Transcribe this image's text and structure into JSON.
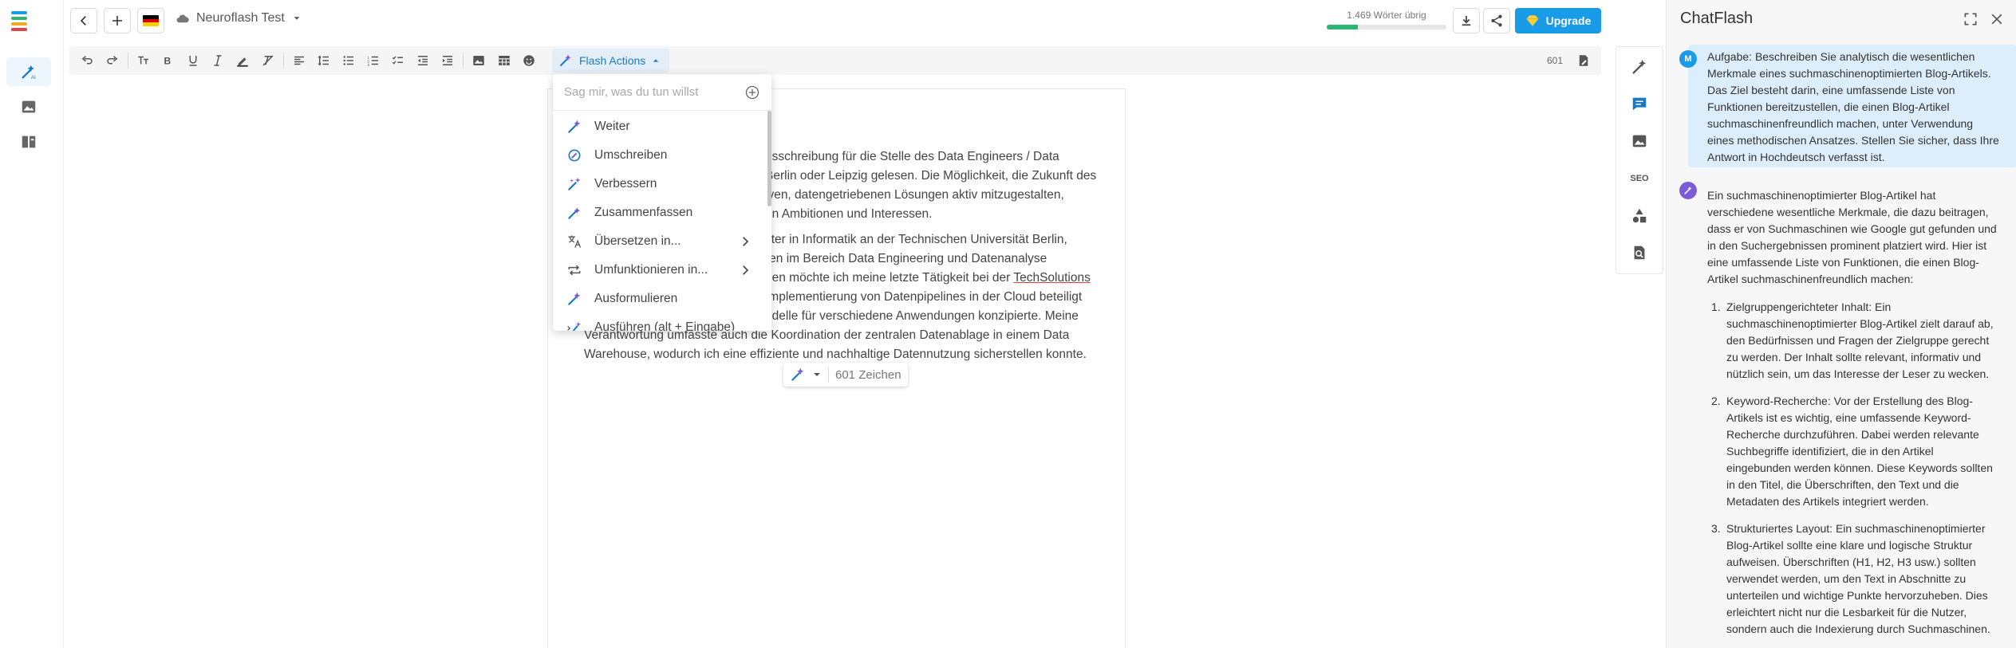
{
  "topbar": {
    "back_icon": "chevron-left-icon",
    "add_icon": "plus-icon",
    "language_flag": "german-flag",
    "doc_name": "Neuroflash Test",
    "words_left_label": "1.469 Wörter übrig",
    "words_progress": 0.26,
    "upgrade_label": "Upgrade"
  },
  "toolbar": {
    "flash_actions_label": "Flash Actions",
    "char_count": "601"
  },
  "document": {
    "lines": [
      "usschreibung für die Stelle des Data Engineers / Data",
      "Berlin oder Leipzig gelesen. Die Möglichkeit, die Zukunft des",
      "iven, datengetriebenen Lösungen aktiv mitzugestalten,",
      "en Ambitionen und Interessen.",
      "ster in Informatik an der Technischen Universität Berlin,",
      "ren im Bereich Data Engineering und Datenanalyse",
      "ben möchte ich meine letzte Tätigkeit bei der ",
      " Implementierung von Datenpipelines in der Cloud beteiligt",
      "odelle für verschiedene Anwendungen konzipierte. Meine",
      "Verantwortung umfasste auch die Koordination der zentralen Datenablage in einem Data",
      "Warehouse, wodurch ich eine effiziente und nachhaltige Datennutzung sicherstellen konnte."
    ],
    "highlight_word": "TechSolutions"
  },
  "menu": {
    "placeholder": "Sag mir, was du tun willst",
    "items": [
      {
        "label": "Weiter"
      },
      {
        "label": "Umschreiben"
      },
      {
        "label": "Verbessern"
      },
      {
        "label": "Zusammenfassen"
      },
      {
        "label": "Übersetzen in..."
      },
      {
        "label": "Umfunktionieren in..."
      },
      {
        "label": "Ausformulieren"
      },
      {
        "label": "Ausführen (alt + Eingabe)"
      }
    ]
  },
  "char_pill": {
    "label": "601 Zeichen"
  },
  "tool_strip": {
    "seo_label": "SEO"
  },
  "chat": {
    "title": "ChatFlash",
    "user_avatar": "M",
    "user_message": [
      "Aufgabe: Beschreiben Sie analytisch die wesentlichen",
      "Merkmale eines suchmaschinenoptimierten Blog-Artikels.",
      "Das Ziel besteht darin, eine umfassende Liste von",
      "Funktionen bereitzustellen, die einen Blog-Artikel",
      "suchmaschinenfreundlich machen, unter Verwendung",
      "eines methodischen Ansatzes. Stellen Sie sicher, dass Ihre",
      "Antwort in Hochdeutsch verfasst ist."
    ],
    "reply_intro": [
      "Ein suchmaschinenoptimierter Blog-Artikel hat",
      "verschiedene wesentliche Merkmale, die dazu beitragen,",
      "dass er von Suchmaschinen wie Google gut gefunden und",
      "in den Suchergebnissen prominent platziert wird. Hier ist",
      "eine umfassende Liste von Funktionen, die einen Blog-",
      "Artikel suchmaschinenfreundlich machen:"
    ],
    "reply_points": [
      {
        "num": "1.",
        "lines": [
          "Zielgruppengerichteter Inhalt: Ein",
          "suchmaschinenoptimierter Blog-Artikel zielt darauf ab,",
          "den Bedürfnissen und Fragen der Zielgruppe gerecht",
          "zu werden. Der Inhalt sollte relevant, informativ und",
          "nützlich sein, um das Interesse der Leser zu wecken."
        ]
      },
      {
        "num": "2.",
        "lines": [
          "Keyword-Recherche: Vor der Erstellung des Blog-",
          "Artikels ist es wichtig, eine umfassende Keyword-",
          "Recherche durchzuführen. Dabei werden relevante",
          "Suchbegriffe identifiziert, die in den Artikel",
          "eingebunden werden können. Diese Keywords sollten",
          "in den Titel, die Überschriften, den Text und die",
          "Metadaten des Artikels integriert werden."
        ]
      },
      {
        "num": "3.",
        "lines": [
          "Strukturiertes Layout: Ein suchmaschinenoptimierter",
          "Blog-Artikel sollte eine klare und logische Struktur",
          "aufweisen. Überschriften (H1, H2, H3 usw.) sollten",
          "verwendet werden, um den Text in Abschnitte zu",
          "unterteilen und wichtige Punkte hervorzuheben. Dies",
          "erleichtert nicht nur die Lesbarkeit für die Nutzer,",
          "sondern auch die Indexierung durch Suchmaschinen."
        ]
      }
    ]
  },
  "colors": {
    "accent": "#1a9be8",
    "progress": "#2bb673",
    "user_bubble": "#dceefb",
    "flash_purple": "#7b5cd6"
  }
}
